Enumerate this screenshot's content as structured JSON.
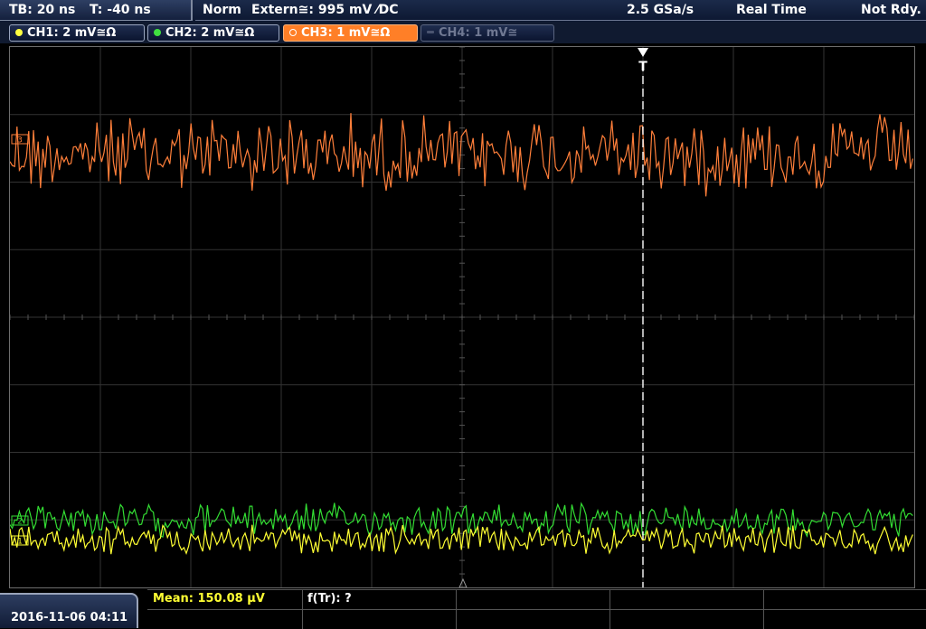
{
  "topbar": {
    "timebase": "TB: 20 ns",
    "trigger_time": "T: -40 ns",
    "mode": "Norm",
    "trigger_source": "Extern≅: 995 mV ⁄DC",
    "sample_rate": "2.5 GSa/s",
    "acquisition": "Real Time",
    "status": "Not Rdy."
  },
  "channels": [
    {
      "label": "CH1: 2 mV≅Ω",
      "color": "#ffff40",
      "state": "on"
    },
    {
      "label": "CH2: 2 mV≅Ω",
      "color": "#40e040",
      "state": "on"
    },
    {
      "label": "CH3: 1 mV≅Ω",
      "color": "#ff8030",
      "state": "active"
    },
    {
      "label": "CH4: 1 mV≅",
      "color": "#6f7892",
      "state": "off"
    }
  ],
  "waveform_markers": {
    "ch3": "3",
    "ch2": "2",
    "ch1": "1",
    "trigger": "T"
  },
  "footer": {
    "datetime": "2016-11-06 04:11",
    "measurement_mean": "Mean: 150.08 µV",
    "measurement_freq": "f(Tr): ?"
  },
  "colors": {
    "ch1": "#ffff33",
    "ch2": "#33dd33",
    "ch3": "#ff7f3a",
    "grid": "#3a3a3a",
    "trigger_line": "#ffffff"
  }
}
